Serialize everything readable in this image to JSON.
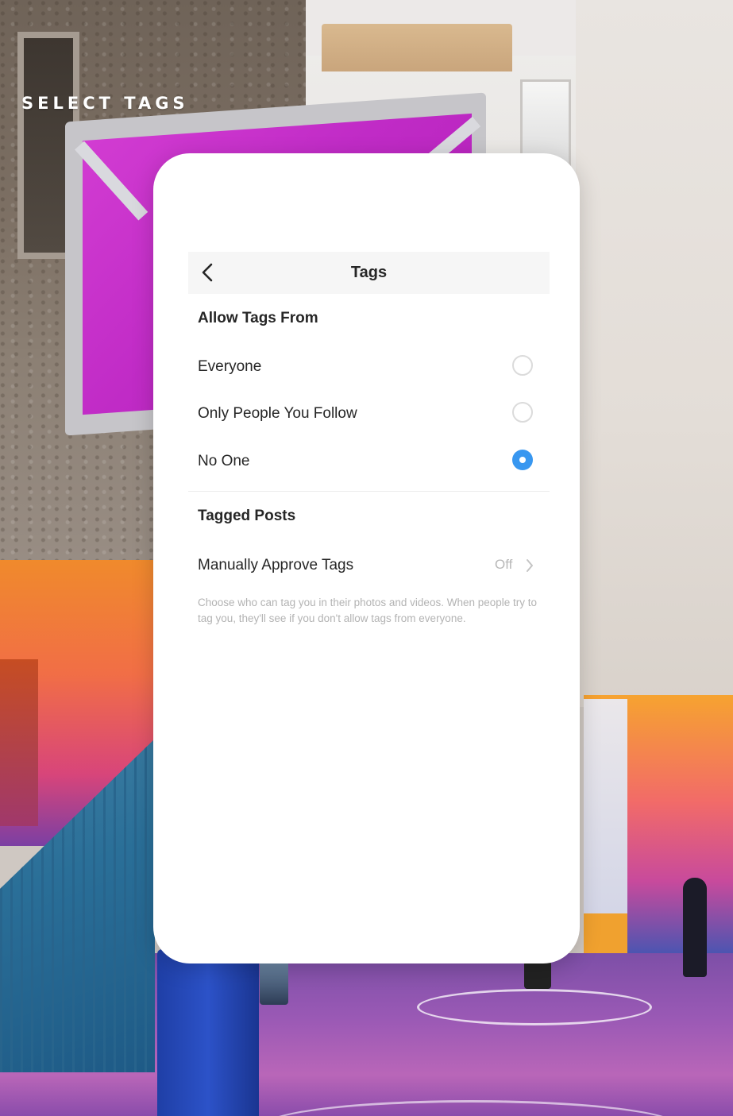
{
  "overlay": {
    "title": "SELECT TAGS"
  },
  "screen": {
    "nav": {
      "back_icon": "chevron-left-icon",
      "title": "Tags"
    },
    "allow_tags_section": {
      "heading": "Allow Tags From",
      "options": [
        {
          "label": "Everyone",
          "selected": false
        },
        {
          "label": "Only People You Follow",
          "selected": false
        },
        {
          "label": "No One",
          "selected": true
        }
      ]
    },
    "tagged_posts_section": {
      "heading": "Tagged Posts",
      "manual_approve": {
        "label": "Manually Approve Tags",
        "value": "Off",
        "icon": "chevron-right-icon"
      }
    },
    "help_text": "Choose who can tag you in their photos and videos. When people try to tag you, they'll see if you don't allow tags from everyone."
  },
  "colors": {
    "accent": "#3897f0",
    "text_primary": "#262626",
    "text_secondary": "#b3b3b3",
    "card_background": "#ffffff",
    "nav_background": "#f6f6f6"
  }
}
